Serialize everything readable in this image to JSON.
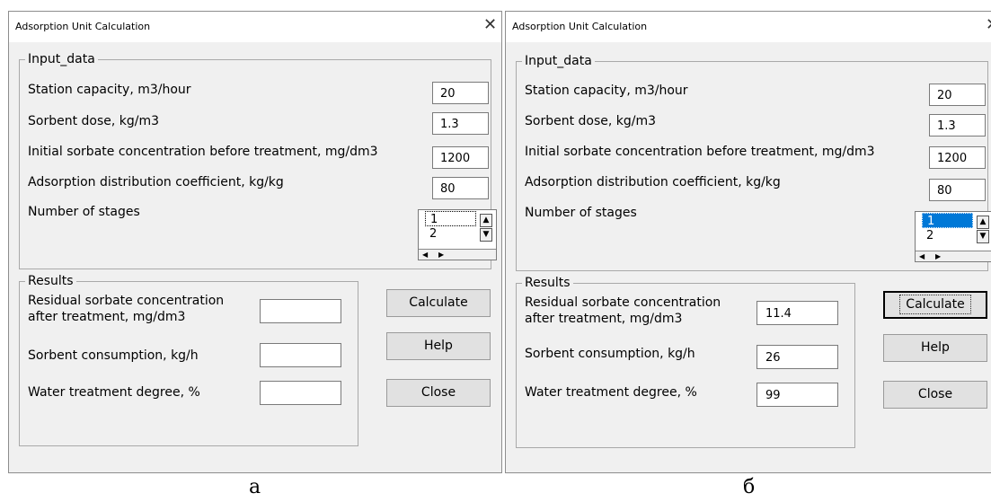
{
  "windows": [
    {
      "title": "Adsorption Unit Calculation",
      "input_frame": "Input_data",
      "inputs": [
        {
          "label": "Station capacity, m3/hour",
          "value": "20"
        },
        {
          "label": "Sorbent dose, kg/m3",
          "value": "1.3"
        },
        {
          "label": "Initial sorbate concentration before treatment, mg/dm3",
          "value": "1200"
        },
        {
          "label": "Adsorption distribution coefficient, kg/kg",
          "value": "80"
        }
      ],
      "stages_label": "Number of stages",
      "stages_options": [
        "1",
        "2"
      ],
      "stages_selected": false,
      "results_frame": "Results",
      "results": [
        {
          "label": "Residual sorbate concentration after treatment, mg/dm3",
          "value": ""
        },
        {
          "label": "Sorbent consumption, kg/h",
          "value": ""
        },
        {
          "label": "Water treatment degree, %",
          "value": ""
        }
      ],
      "buttons": {
        "calculate": "Calculate",
        "help": "Help",
        "close": "Close"
      },
      "caption": "а"
    },
    {
      "title": "Adsorption Unit Calculation",
      "input_frame": "Input_data",
      "inputs": [
        {
          "label": "Station capacity, m3/hour",
          "value": "20"
        },
        {
          "label": "Sorbent dose, kg/m3",
          "value": "1.3"
        },
        {
          "label": "Initial sorbate concentration before treatment, mg/dm3",
          "value": "1200"
        },
        {
          "label": "Adsorption distribution coefficient, kg/kg",
          "value": "80"
        }
      ],
      "stages_label": "Number of stages",
      "stages_options": [
        "1",
        "2"
      ],
      "stages_selected": true,
      "results_frame": "Results",
      "results": [
        {
          "label": "Residual sorbate concentration after treatment, mg/dm3",
          "value": "11.4"
        },
        {
          "label": "Sorbent consumption, kg/h",
          "value": "26"
        },
        {
          "label": "Water treatment degree, %",
          "value": "99"
        }
      ],
      "buttons": {
        "calculate": "Calculate",
        "help": "Help",
        "close": "Close"
      },
      "caption": "б"
    }
  ],
  "colors": {
    "selection": "#0078d7",
    "dialog_bg": "#f0f0f0"
  },
  "icons": {
    "close": "close-icon",
    "scroll_up": "scroll-up-arrow-icon",
    "scroll_down": "scroll-down-arrow-icon"
  }
}
